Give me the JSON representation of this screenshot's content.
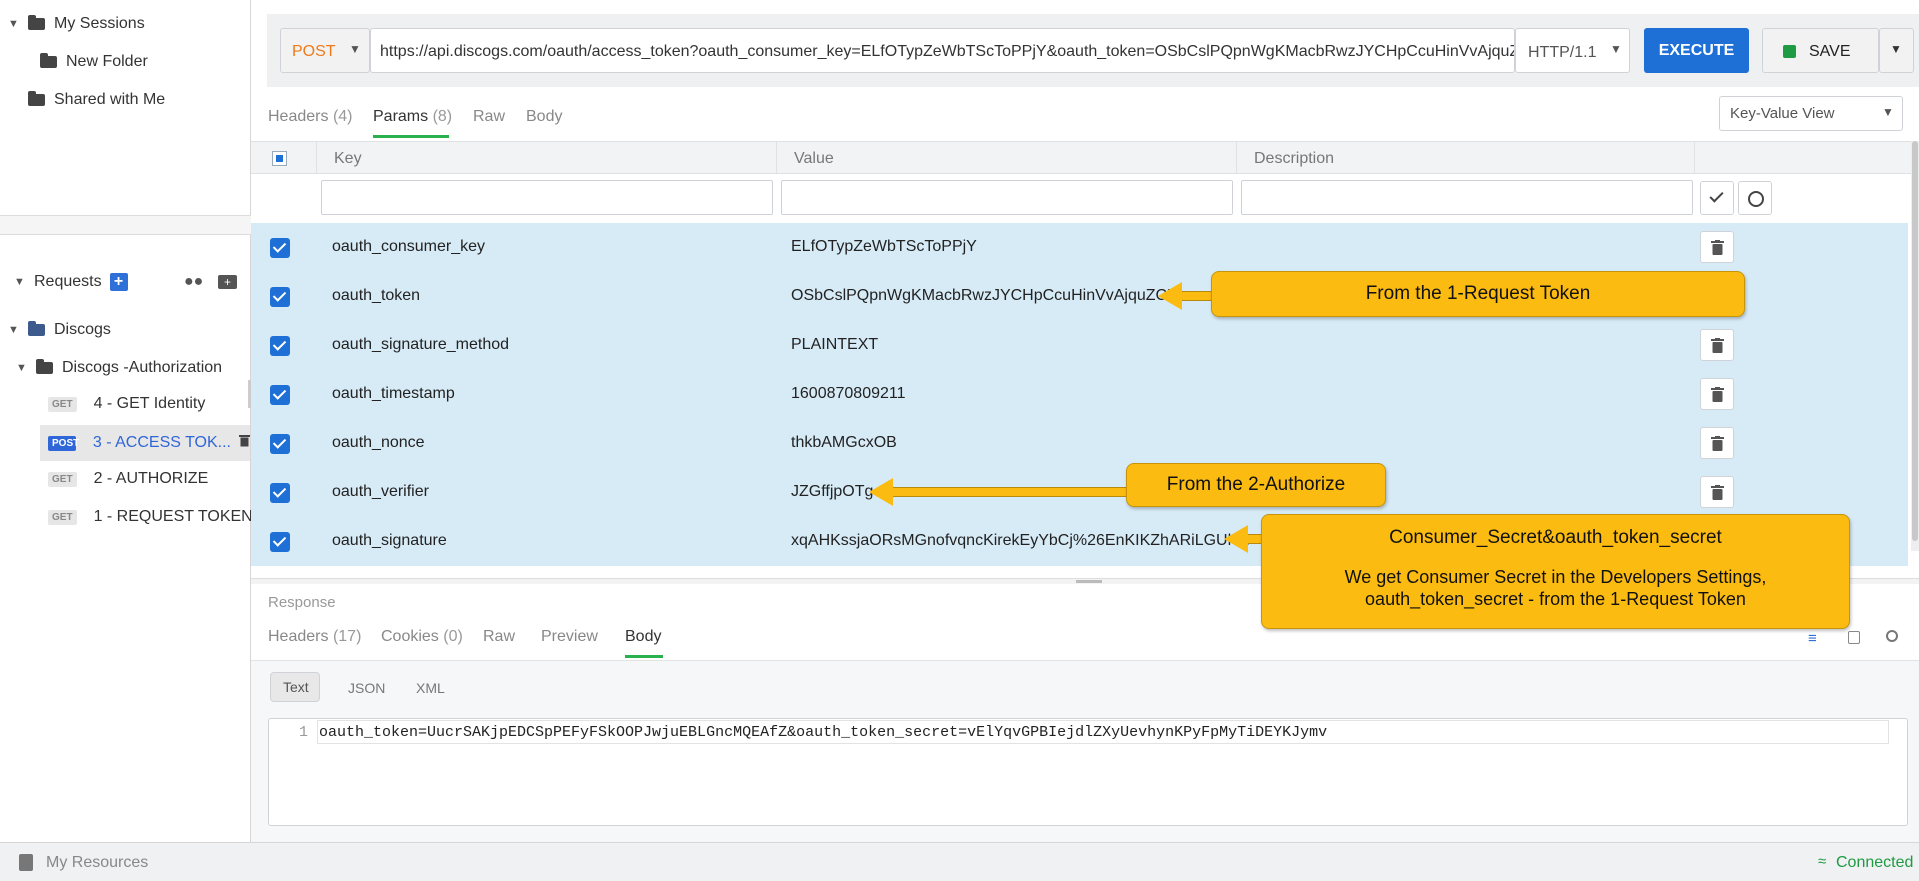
{
  "sidebar": {
    "my_sessions": "My Sessions",
    "new_folder": "New Folder",
    "shared_with_me": "Shared with Me",
    "requests_label": "Requests",
    "collection": "Discogs",
    "folder": "Discogs -Authorization",
    "items": [
      {
        "method": "GET",
        "label": "4 - GET Identity"
      },
      {
        "method": "POST",
        "label": "3 - ACCESS TOK..."
      },
      {
        "method": "GET",
        "label": "2 - AUTHORIZE"
      },
      {
        "method": "GET",
        "label": "1 - REQUEST TOKEN"
      }
    ]
  },
  "request": {
    "method": "POST",
    "url": "https://api.discogs.com/oauth/access_token?oauth_consumer_key=ELfOTypZeWbTScToPPjY&oauth_token=OSbCslPQpnWgKMacbRwzJYCHpCcuHinVvAjquZCX&oa",
    "protocol": "HTTP/1.1",
    "execute_label": "EXECUTE",
    "save_label": "SAVE"
  },
  "request_tabs": [
    {
      "label": "Headers",
      "count": "(4)"
    },
    {
      "label": "Params",
      "count": "(8)"
    },
    {
      "label": "Raw",
      "count": ""
    },
    {
      "label": "Body",
      "count": ""
    }
  ],
  "view_select": "Key-Value View",
  "params_table": {
    "headers": [
      "Key",
      "Value",
      "Description"
    ],
    "rows": [
      {
        "key": "oauth_consumer_key",
        "value": "ELfOTypZeWbTScToPPjY"
      },
      {
        "key": "oauth_token",
        "value": "OSbCslPQpnWgKMacbRwzJYCHpCcuHinVvAjquZCX"
      },
      {
        "key": "oauth_signature_method",
        "value": "PLAINTEXT"
      },
      {
        "key": "oauth_timestamp",
        "value": "1600870809211"
      },
      {
        "key": "oauth_nonce",
        "value": "thkbAMGcxOB"
      },
      {
        "key": "oauth_verifier",
        "value": "JZGffjpOTg"
      },
      {
        "key": "oauth_signature",
        "value": "xqAHKssjaORsMGnofvqncKirekEyYbCj%26EnKIKZhARiLGUh..."
      }
    ]
  },
  "callouts": {
    "request_token": "From the 1-Request Token",
    "authorize": "From the 2-Authorize",
    "secret_title": "Consumer_Secret&oauth_token_secret",
    "secret_line1": "We get Consumer Secret in the Developers Settings,",
    "secret_line2": "oauth_token_secret - from the 1-Request Token"
  },
  "response": {
    "label": "Response",
    "tabs": [
      {
        "label": "Headers",
        "count": "(17)"
      },
      {
        "label": "Cookies",
        "count": "(0)"
      },
      {
        "label": "Raw",
        "count": ""
      },
      {
        "label": "Preview",
        "count": ""
      },
      {
        "label": "Body",
        "count": ""
      }
    ],
    "format_tabs": [
      "Text",
      "JSON",
      "XML"
    ],
    "line_number": "1",
    "body": "oauth_token=UucrSAKjpEDCSpPEFyFSkOOPJwjuEBLGncMQEAfZ&oauth_token_secret=vElYqvGPBIejdlZXyUevhynKPyFpMyTiDEYKJymv"
  },
  "footer": {
    "my_resources": "My Resources",
    "status": "Connected"
  },
  "colors": {
    "accent_blue": "#1e6fd6",
    "tab_green": "#28b14c",
    "callout_yellow": "#fbbb10",
    "row_highlight": "#d7ebf7",
    "method_orange": "#f07a1a"
  }
}
